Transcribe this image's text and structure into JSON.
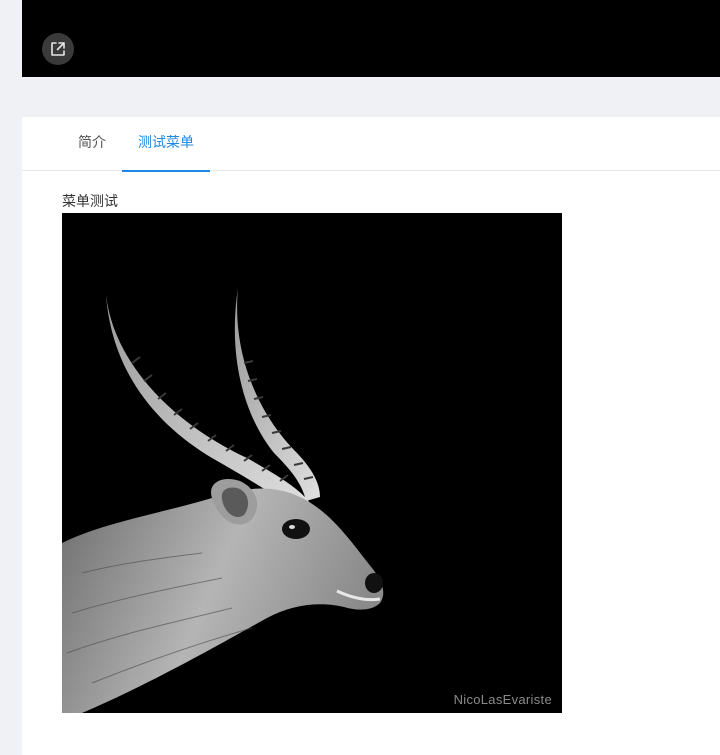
{
  "player": {
    "external_icon": "external-link-icon"
  },
  "tabs": [
    {
      "label": "简介",
      "active": false
    },
    {
      "label": "测试菜单",
      "active": true
    }
  ],
  "content": {
    "section_label": "菜单测试",
    "image": {
      "subject": "antelope-portrait",
      "watermark": "NicoLasEvariste"
    }
  },
  "colors": {
    "accent": "#1e88e5",
    "page_bg": "#f0f1f4",
    "panel_bg": "#000000"
  }
}
